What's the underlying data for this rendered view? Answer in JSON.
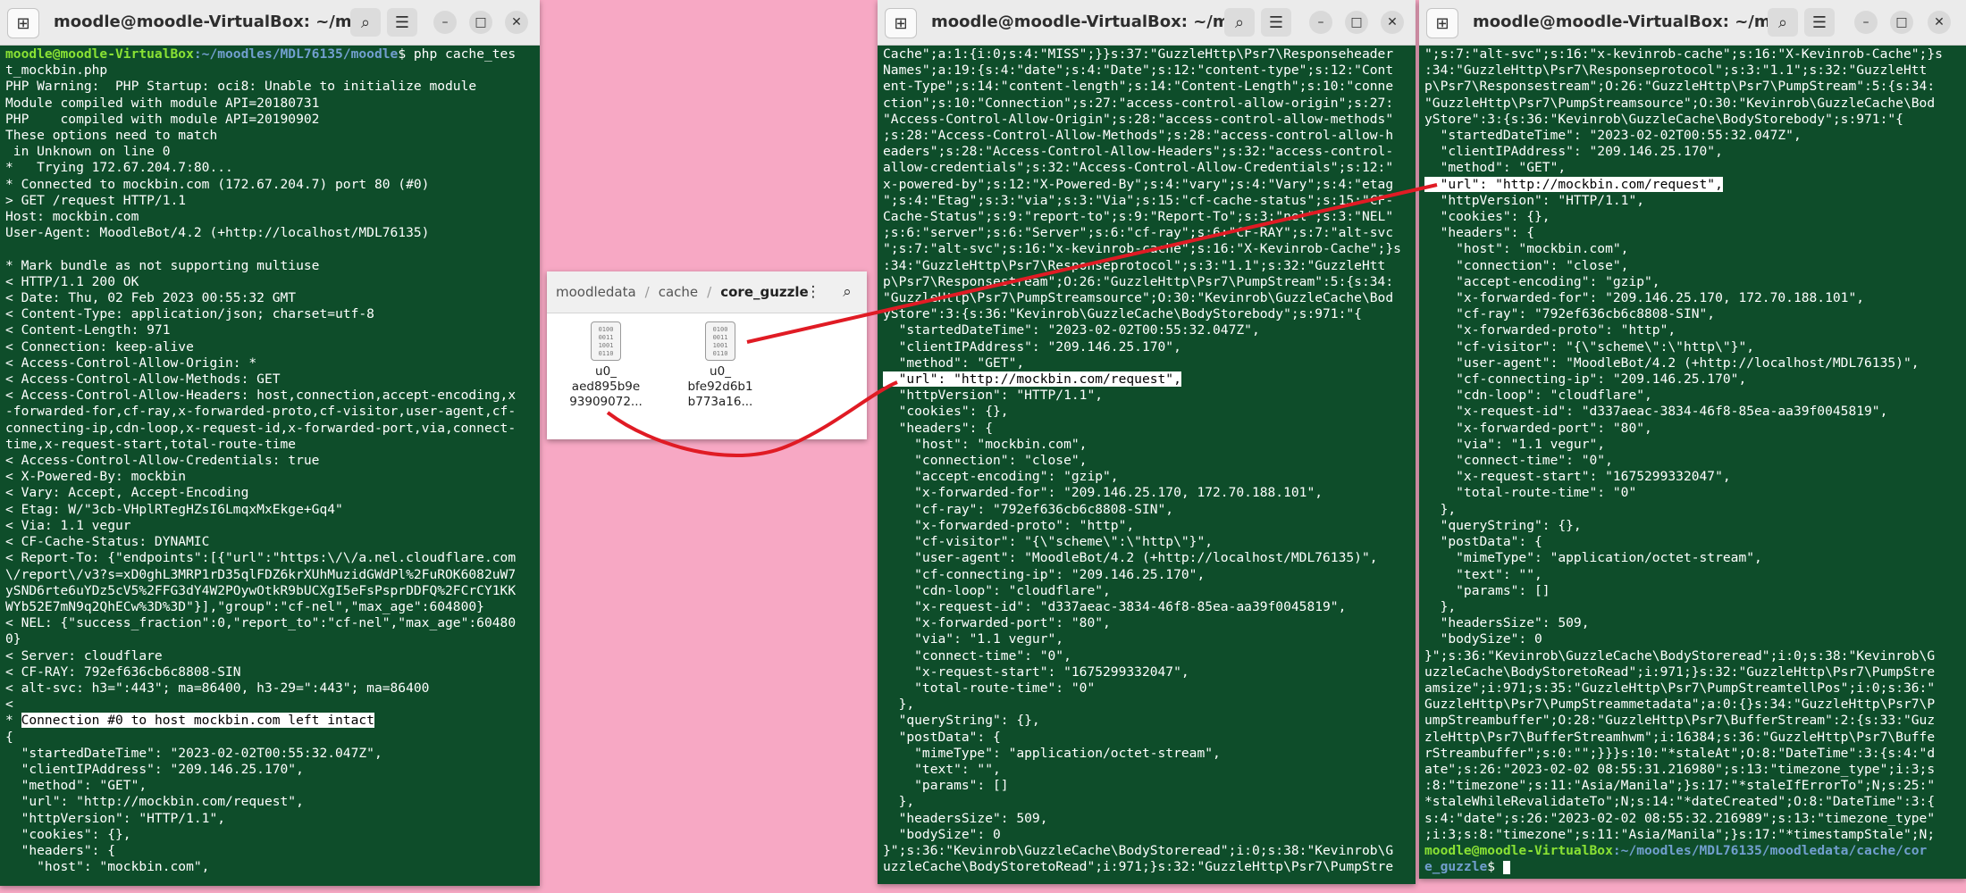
{
  "win1": {
    "title": "moodle@moodle-VirtualBox: ~/moodles/...",
    "prompt_user": "moodle@moodle-VirtualBox",
    "prompt_path": ":~/moodles/MDL76135/moodle",
    "prompt_cmd": "$ php cache_tes",
    "lines": [
      "t_mockbin.php",
      "PHP Warning:  PHP Startup: oci8: Unable to initialize module",
      "Module compiled with module API=20180731",
      "PHP    compiled with module API=20190902",
      "These options need to match",
      " in Unknown on line 0",
      "*   Trying 172.67.204.7:80...",
      "* Connected to mockbin.com (172.67.204.7) port 80 (#0)",
      "> GET /request HTTP/1.1",
      "Host: mockbin.com",
      "User-Agent: MoodleBot/4.2 (+http://localhost/MDL76135)",
      "",
      "* Mark bundle as not supporting multiuse",
      "< HTTP/1.1 200 OK",
      "< Date: Thu, 02 Feb 2023 00:55:32 GMT",
      "< Content-Type: application/json; charset=utf-8",
      "< Content-Length: 971",
      "< Connection: keep-alive",
      "< Access-Control-Allow-Origin: *",
      "< Access-Control-Allow-Methods: GET",
      "< Access-Control-Allow-Headers: host,connection,accept-encoding,x",
      "-forwarded-for,cf-ray,x-forwarded-proto,cf-visitor,user-agent,cf-",
      "connecting-ip,cdn-loop,x-request-id,x-forwarded-port,via,connect-",
      "time,x-request-start,total-route-time",
      "< Access-Control-Allow-Credentials: true",
      "< X-Powered-By: mockbin",
      "< Vary: Accept, Accept-Encoding",
      "< Etag: W/\"3cb-VHplRTegHZsI6LmqxMxEkge+Gq4\"",
      "< Via: 1.1 vegur",
      "< CF-Cache-Status: DYNAMIC",
      "< Report-To: {\"endpoints\":[{\"url\":\"https:\\/\\/a.nel.cloudflare.com",
      "\\/report\\/v3?s=xD0ghL3MRP1rD35qlFDZ6krXUhMuzidGWdPl%2FuROK6082uW7",
      "ySND6rte6uYDz5cV5%2FFG3dY4W2POywOtkR9bUCXgI5eFsPsprDDFQ%2FCrCY1KK",
      "WYb52E7mN9q2QhECw%3D%3D\"}],\"group\":\"cf-nel\",\"max_age\":604800}",
      "< NEL: {\"success_fraction\":0,\"report_to\":\"cf-nel\",\"max_age\":60480",
      "0}",
      "< Server: cloudflare",
      "< CF-RAY: 792ef636cb6c8808-SIN",
      "< alt-svc: h3=\":443\"; ma=86400, h3-29=\":443\"; ma=86400",
      "<"
    ],
    "intact_prefix": "* ",
    "intact_text": "Connection #0 to host mockbin.com left intact",
    "tail": [
      "{",
      "  \"startedDateTime\": \"2023-02-02T00:55:32.047Z\",",
      "  \"clientIPAddress\": \"209.146.25.170\",",
      "  \"method\": \"GET\",",
      "  \"url\": \"http://mockbin.com/request\",",
      "  \"httpVersion\": \"HTTP/1.1\",",
      "  \"cookies\": {},",
      "  \"headers\": {",
      "    \"host\": \"mockbin.com\","
    ]
  },
  "filemanager": {
    "crumbs": [
      "moodledata",
      "cache",
      "core_guzzle"
    ],
    "menu_icon": "kebab-menu-icon",
    "search_icon": "search-icon",
    "files": [
      {
        "name1": "u0_",
        "name2": "aed895b9e",
        "name3": "93909072..."
      },
      {
        "name1": "u0_",
        "name2": "bfe92d6b1",
        "name3": "b773a16..."
      }
    ],
    "binary_glyph": "0100\n0011\n1001\n0110"
  },
  "win2": {
    "title": "moodle@moodle-VirtualBox: ~/moodles/...",
    "pre": [
      "Cache\";a:1:{i:0;s:4:\"MISS\";}}s:37:\"GuzzleHttp\\Psr7\\Responseheader",
      "Names\";a:19:{s:4:\"date\";s:4:\"Date\";s:12:\"content-type\";s:12:\"Cont",
      "ent-Type\";s:14:\"content-length\";s:14:\"Content-Length\";s:10:\"conne",
      "ction\";s:10:\"Connection\";s:27:\"access-control-allow-origin\";s:27:",
      "\"Access-Control-Allow-Origin\";s:28:\"access-control-allow-methods\"",
      ";s:28:\"Access-Control-Allow-Methods\";s:28:\"access-control-allow-h",
      "eaders\";s:28:\"Access-Control-Allow-Headers\";s:32:\"access-control-",
      "allow-credentials\";s:32:\"Access-Control-Allow-Credentials\";s:12:\"",
      "x-powered-by\";s:12:\"X-Powered-By\";s:4:\"vary\";s:4:\"Vary\";s:4:\"etag",
      "\";s:4:\"Etag\";s:3:\"via\";s:3:\"Via\";s:15:\"cf-cache-status\";s:15:\"CF-",
      "Cache-Status\";s:9:\"report-to\";s:9:\"Report-To\";s:3:\"nel\";s:3:\"NEL\"",
      ";s:6:\"server\";s:6:\"Server\";s:6:\"cf-ray\";s:6:\"CF-RAY\";s:7:\"alt-svc",
      "\";s:7:\"alt-svc\";s:16:\"x-kevinrob-cache\";s:16:\"X-Kevinrob-Cache\";}s",
      ":34:\"GuzzleHttp\\Psr7\\Responseprotocol\";s:3:\"1.1\";s:32:\"GuzzleHtt",
      "p\\Psr7\\Responsestream\";O:26:\"GuzzleHttp\\Psr7\\PumpStream\":5:{s:34:",
      "\"GuzzleHttp\\Psr7\\PumpStreamsource\";O:30:\"Kevinrob\\GuzzleCache\\Bod",
      "yStore\":3:{s:36:\"Kevinrob\\GuzzleCache\\BodyStorebody\";s:971:\"{",
      "  \"startedDateTime\": \"2023-02-02T00:55:32.047Z\",",
      "  \"clientIPAddress\": \"209.146.25.170\",",
      "  \"method\": \"GET\","
    ],
    "url_line": "  \"url\": \"http://mockbin.com/request\",",
    "post": [
      "  \"httpVersion\": \"HTTP/1.1\",",
      "  \"cookies\": {},",
      "  \"headers\": {",
      "    \"host\": \"mockbin.com\",",
      "    \"connection\": \"close\",",
      "    \"accept-encoding\": \"gzip\",",
      "    \"x-forwarded-for\": \"209.146.25.170, 172.70.188.101\",",
      "    \"cf-ray\": \"792ef636cb6c8808-SIN\",",
      "    \"x-forwarded-proto\": \"http\",",
      "    \"cf-visitor\": \"{\\\"scheme\\\":\\\"http\\\"}\",",
      "    \"user-agent\": \"MoodleBot/4.2 (+http://localhost/MDL76135)\",",
      "    \"cf-connecting-ip\": \"209.146.25.170\",",
      "    \"cdn-loop\": \"cloudflare\",",
      "    \"x-request-id\": \"d337aeac-3834-46f8-85ea-aa39f0045819\",",
      "    \"x-forwarded-port\": \"80\",",
      "    \"via\": \"1.1 vegur\",",
      "    \"connect-time\": \"0\",",
      "    \"x-request-start\": \"1675299332047\",",
      "    \"total-route-time\": \"0\"",
      "  },",
      "  \"queryString\": {},",
      "  \"postData\": {",
      "    \"mimeType\": \"application/octet-stream\",",
      "    \"text\": \"\",",
      "    \"params\": []",
      "  },",
      "  \"headersSize\": 509,",
      "  \"bodySize\": 0",
      "}\";s:36:\"Kevinrob\\GuzzleCache\\BodyStoreread\";i:0;s:38:\"Kevinrob\\G",
      "uzzleCache\\BodyStoretoRead\";i:971;}s:32:\"GuzzleHttp\\Psr7\\PumpStre"
    ]
  },
  "win3": {
    "title": "moodle@moodle-VirtualBox: ~/moodles/...",
    "pre": [
      "\";s:7:\"alt-svc\";s:16:\"x-kevinrob-cache\";s:16:\"X-Kevinrob-Cache\";}s",
      ":34:\"GuzzleHttp\\Psr7\\Responseprotocol\";s:3:\"1.1\";s:32:\"GuzzleHtt",
      "p\\Psr7\\Responsestream\";O:26:\"GuzzleHttp\\Psr7\\PumpStream\":5:{s:34:",
      "\"GuzzleHttp\\Psr7\\PumpStreamsource\";O:30:\"Kevinrob\\GuzzleCache\\Bod",
      "yStore\":3:{s:36:\"Kevinrob\\GuzzleCache\\BodyStorebody\";s:971:\"{",
      "  \"startedDateTime\": \"2023-02-02T00:55:32.047Z\",",
      "  \"clientIPAddress\": \"209.146.25.170\",",
      "  \"method\": \"GET\","
    ],
    "url_line": "  \"url\": \"http://mockbin.com/request\",",
    "post": [
      "  \"httpVersion\": \"HTTP/1.1\",",
      "  \"cookies\": {},",
      "  \"headers\": {",
      "    \"host\": \"mockbin.com\",",
      "    \"connection\": \"close\",",
      "    \"accept-encoding\": \"gzip\",",
      "    \"x-forwarded-for\": \"209.146.25.170, 172.70.188.101\",",
      "    \"cf-ray\": \"792ef636cb6c8808-SIN\",",
      "    \"x-forwarded-proto\": \"http\",",
      "    \"cf-visitor\": \"{\\\"scheme\\\":\\\"http\\\"}\",",
      "    \"user-agent\": \"MoodleBot/4.2 (+http://localhost/MDL76135)\",",
      "    \"cf-connecting-ip\": \"209.146.25.170\",",
      "    \"cdn-loop\": \"cloudflare\",",
      "    \"x-request-id\": \"d337aeac-3834-46f8-85ea-aa39f0045819\",",
      "    \"x-forwarded-port\": \"80\",",
      "    \"via\": \"1.1 vegur\",",
      "    \"connect-time\": \"0\",",
      "    \"x-request-start\": \"1675299332047\",",
      "    \"total-route-time\": \"0\"",
      "  },",
      "  \"queryString\": {},",
      "  \"postData\": {",
      "    \"mimeType\": \"application/octet-stream\",",
      "    \"text\": \"\",",
      "    \"params\": []",
      "  },",
      "  \"headersSize\": 509,",
      "  \"bodySize\": 0",
      "}\";s:36:\"Kevinrob\\GuzzleCache\\BodyStoreread\";i:0;s:38:\"Kevinrob\\G",
      "uzzleCache\\BodyStoretoRead\";i:971;}s:32:\"GuzzleHttp\\Psr7\\PumpStre",
      "amsize\";i:971;s:35:\"GuzzleHttp\\Psr7\\PumpStreamtellPos\";i:0;s:36:\"",
      "GuzzleHttp\\Psr7\\PumpStreammetadata\";a:0:{}s:34:\"GuzzleHttp\\Psr7\\P",
      "umpStreambuffer\";O:28:\"GuzzleHttp\\Psr7\\BufferStream\":2:{s:33:\"Guz",
      "zleHttp\\Psr7\\BufferStreamhwm\";i:16384;s:36:\"GuzzleHttp\\Psr7\\Buffe",
      "rStreambuffer\";s:0:\"\";}}}s:10:\"*staleAt\";O:8:\"DateTime\":3:{s:4:\"d",
      "ate\";s:26:\"2023-02-02 08:55:31.216980\";s:13:\"timezone_type\";i:3;s",
      ":8:\"timezone\";s:11:\"Asia/Manila\";}s:17:\"*staleIfErrorTo\";N;s:25:\"",
      "*staleWhileRevalidateTo\";N;s:14:\"*dateCreated\";O:8:\"DateTime\":3:{",
      "s:4:\"date\";s:26:\"2023-02-02 08:55:32.216989\";s:13:\"timezone_type\"",
      ";i:3;s:8:\"timezone\";s:11:\"Asia/Manila\";}s:17:\"*timestampStale\";N;"
    ],
    "prompt_user": "moodle@moodle-VirtualBox",
    "prompt_path": ":~/moodles/MDL76135/moodledata/cache/cor",
    "prompt_path2": "e_guzzle",
    "prompt_end": "$ "
  },
  "icons": {
    "new_tab": "new-tab-icon",
    "search": "search-icon",
    "menu": "hamburger-menu-icon",
    "minimize": "minimize-icon",
    "maximize": "maximize-icon",
    "close": "close-icon"
  },
  "colors": {
    "desktop": "#f7a8c4",
    "terminal_bg": "#0e4d2a",
    "prompt_user": "#8ae234",
    "prompt_path": "#729fcf",
    "annotation": "#e01b24"
  }
}
